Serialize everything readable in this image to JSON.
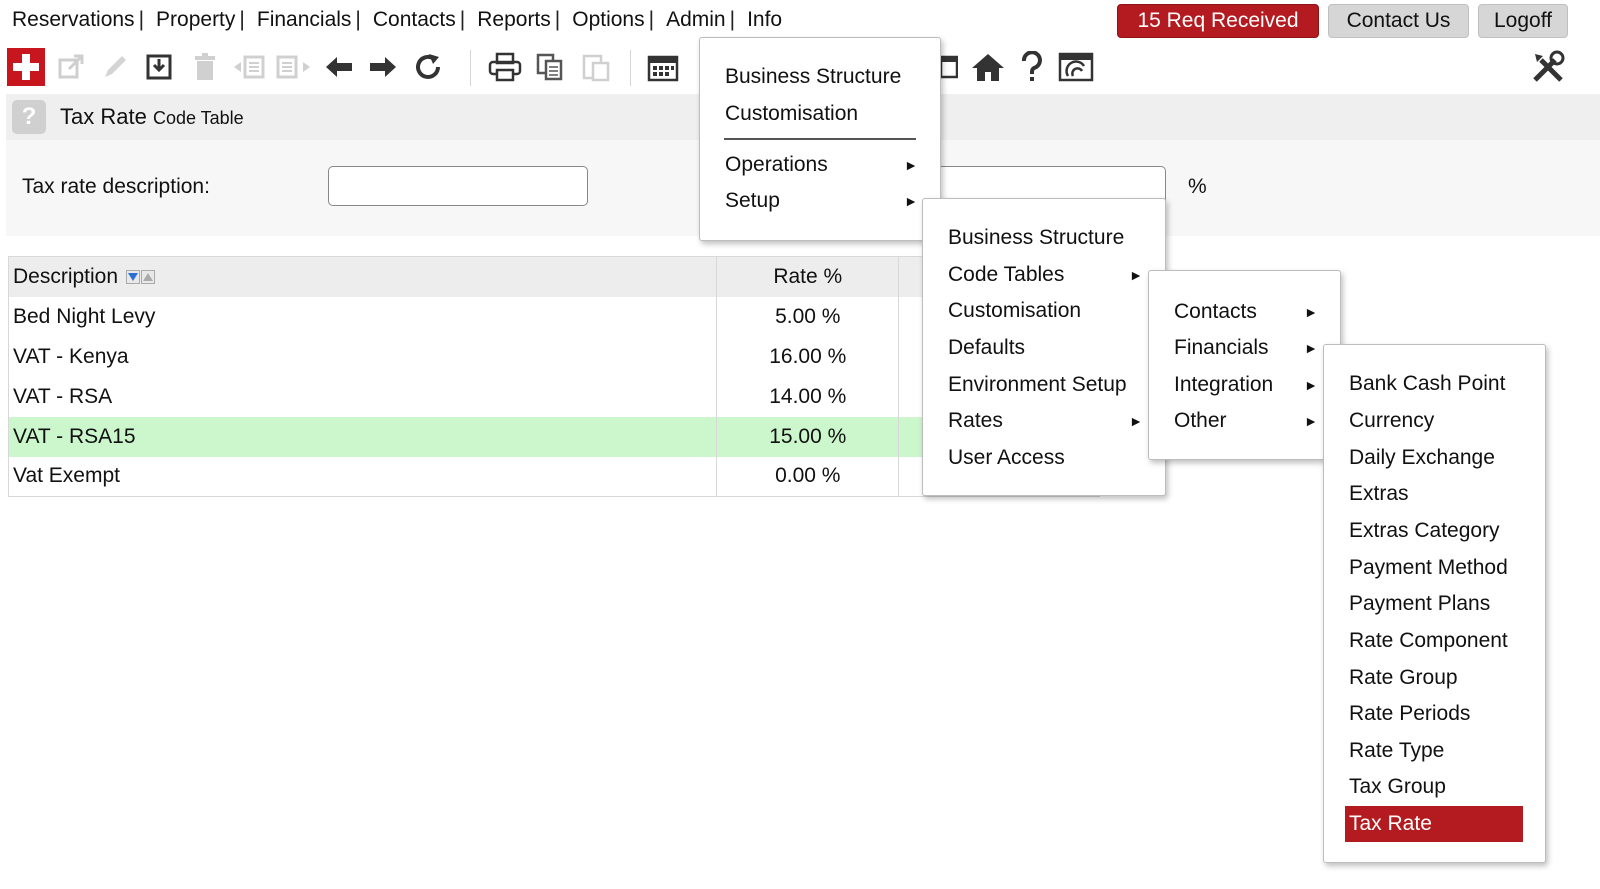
{
  "top_menu": {
    "items": [
      {
        "label": "Reservations"
      },
      {
        "label": "Property"
      },
      {
        "label": "Financials"
      },
      {
        "label": "Contacts"
      },
      {
        "label": "Reports"
      },
      {
        "label": "Options"
      },
      {
        "label": "Admin"
      },
      {
        "label": "Info"
      }
    ],
    "separator": "|"
  },
  "header_buttons": {
    "requests": "15 Req Received",
    "contact_us": "Contact Us",
    "logoff": "Logoff"
  },
  "colors": {
    "accent_red": "#b31b20",
    "selected_row": "#ccf6cc",
    "toolbar_icon": "#333333",
    "toolbar_icon_disabled": "#c8c8c8"
  },
  "toolbar": {
    "icons": [
      "add-icon",
      "edit-link-icon",
      "pencil-icon",
      "save-icon",
      "trash-icon",
      "move-left-icon",
      "move-right-icon",
      "back-arrow-icon",
      "forward-arrow-icon",
      "refresh-icon",
      "print-icon",
      "copy-icon",
      "paste-icon",
      "calendar-icon",
      "window-icon",
      "home-icon",
      "help-icon",
      "screen-capture-icon",
      "tools-icon"
    ]
  },
  "title_bar": {
    "help_glyph": "?",
    "title": "Tax Rate",
    "subtitle": "Code Table"
  },
  "filter": {
    "description_label": "Tax rate description:",
    "description_value": "",
    "rate_value": "",
    "percent_symbol": "%"
  },
  "table": {
    "columns": [
      "Description",
      "Rate %"
    ],
    "rows": [
      {
        "description": "Bed Night Levy",
        "rate": "5.00 %"
      },
      {
        "description": "VAT - Kenya",
        "rate": "16.00 %"
      },
      {
        "description": "VAT - RSA",
        "rate": "14.00 %"
      },
      {
        "description": "VAT - RSA15",
        "rate": "15.00 %",
        "selected": true
      },
      {
        "description": "Vat Exempt",
        "rate": "0.00 %"
      }
    ]
  },
  "menus": {
    "admin": {
      "items": [
        {
          "label": "Business Structure"
        },
        {
          "label": "Customisation"
        },
        {
          "label": "Operations",
          "submenu": true
        },
        {
          "label": "Setup",
          "submenu": true
        }
      ]
    },
    "setup": {
      "items": [
        {
          "label": "Business Structure"
        },
        {
          "label": "Code Tables",
          "submenu": true
        },
        {
          "label": "Customisation"
        },
        {
          "label": "Defaults"
        },
        {
          "label": "Environment Setup"
        },
        {
          "label": "Rates",
          "submenu": true
        },
        {
          "label": "User Access"
        }
      ]
    },
    "code_tables": {
      "items": [
        {
          "label": "Contacts",
          "submenu": true
        },
        {
          "label": "Financials",
          "submenu": true
        },
        {
          "label": "Integration",
          "submenu": true
        },
        {
          "label": "Other",
          "submenu": true
        }
      ]
    },
    "financials": {
      "items": [
        {
          "label": "Bank Cash Point"
        },
        {
          "label": "Currency"
        },
        {
          "label": "Daily Exchange"
        },
        {
          "label": "Extras"
        },
        {
          "label": "Extras Category"
        },
        {
          "label": "Payment Method"
        },
        {
          "label": "Payment Plans"
        },
        {
          "label": "Rate Component"
        },
        {
          "label": "Rate Group"
        },
        {
          "label": "Rate Periods"
        },
        {
          "label": "Rate Type"
        },
        {
          "label": "Tax Group"
        },
        {
          "label": "Tax Rate",
          "active": true
        }
      ]
    },
    "submenu_arrow": "►"
  }
}
